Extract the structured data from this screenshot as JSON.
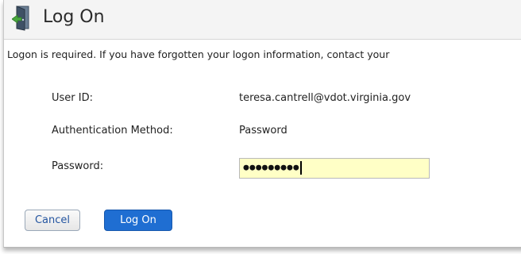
{
  "dialog": {
    "title": "Log On",
    "notice": "Logon is required. If you have forgotten your logon information, contact your",
    "fields": {
      "user_id": {
        "label": "User ID:",
        "value": "teresa.cantrell@vdot.virginia.gov"
      },
      "auth_method": {
        "label": "Authentication Method:",
        "value": "Password"
      },
      "password": {
        "label": "Password:",
        "masked_value": "●●●●●●●●●"
      }
    },
    "buttons": {
      "cancel": "Cancel",
      "logon": "Log On"
    },
    "icon": "door-exit-icon"
  },
  "colors": {
    "primary_button": "#1f6ed2",
    "input_highlight": "#ffffc6",
    "header_bg": "#f4f4f4"
  }
}
